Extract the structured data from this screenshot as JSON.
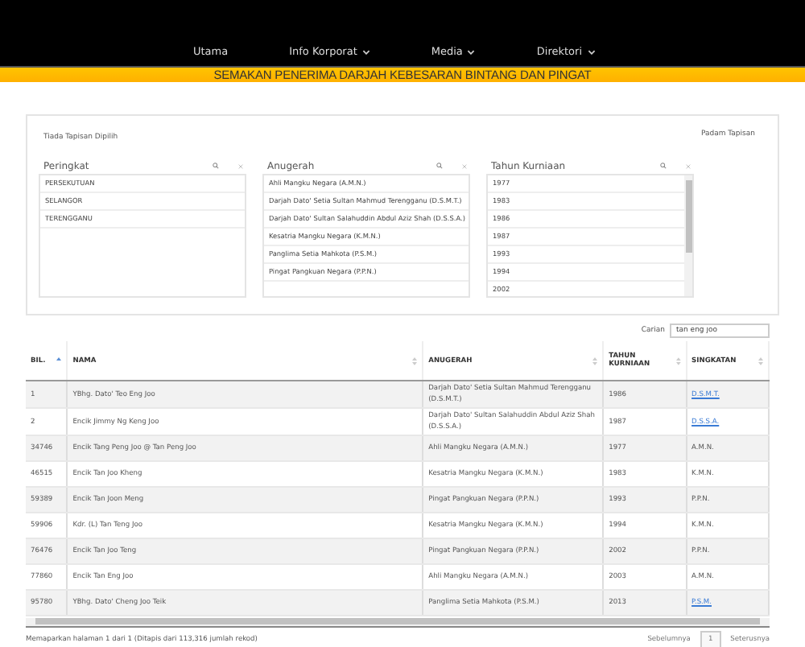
{
  "nav": [
    {
      "label": "Utama",
      "dropdown": false
    },
    {
      "label": "Info Korporat",
      "dropdown": true
    },
    {
      "label": "Media",
      "dropdown": true
    },
    {
      "label": "Direktori",
      "dropdown": true
    }
  ],
  "banner": "SEMAKAN PENERIMA DARJAH KEBESARAN BINTANG DAN PINGAT",
  "filter": {
    "status": "Tiada Tapisan Dipilih",
    "clear": "Padam Tapisan",
    "panes": [
      {
        "title": "Peringkat",
        "scroll": false,
        "items": [
          "PERSEKUTUAN",
          "SELANGOR",
          "TERENGGANU"
        ]
      },
      {
        "title": "Anugerah",
        "scroll": false,
        "items": [
          "Ahli Mangku Negara (A.M.N.)",
          "Darjah Dato' Setia Sultan Mahmud Terengganu (D.S.M.T.)",
          "Darjah Dato' Sultan Salahuddin Abdul Aziz Shah (D.S.S.A.)",
          "Kesatria Mangku Negara (K.M.N.)",
          "Panglima Setia Mahkota (P.S.M.)",
          "Pingat Pangkuan Negara (P.P.N.)"
        ]
      },
      {
        "title": "Tahun Kurniaan",
        "scroll": true,
        "items": [
          "1977",
          "1983",
          "1986",
          "1987",
          "1993",
          "1994",
          "2002"
        ]
      }
    ]
  },
  "search": {
    "label": "Carian",
    "value": "tan eng joo"
  },
  "table": {
    "columns": [
      {
        "label": "BIL.",
        "sorted": true
      },
      {
        "label": "NAMA",
        "sorted": false
      },
      {
        "label": "ANUGERAH",
        "sorted": false
      },
      {
        "label": "TAHUN KURNIAAN",
        "sorted": false
      },
      {
        "label": "SINGKATAN",
        "sorted": false
      }
    ],
    "rows": [
      {
        "bil": "1",
        "nama": "YBhg. Dato' Teo Eng Joo",
        "anugerah": "Darjah Dato' Setia Sultan Mahmud Terengganu (D.S.M.T.)",
        "tahun": "1986",
        "singkatan": "D.S.M.T.",
        "link": true
      },
      {
        "bil": "2",
        "nama": "Encik Jimmy Ng Keng Joo",
        "anugerah": "Darjah Dato' Sultan Salahuddin Abdul Aziz Shah (D.S.S.A.)",
        "tahun": "1987",
        "singkatan": "D.S.S.A.",
        "link": true
      },
      {
        "bil": "34746",
        "nama": "Encik Tang Peng Joo @ Tan Peng Joo",
        "anugerah": "Ahli Mangku Negara (A.M.N.)",
        "tahun": "1977",
        "singkatan": "A.M.N.",
        "link": false
      },
      {
        "bil": "46515",
        "nama": "Encik Tan Joo Kheng",
        "anugerah": "Kesatria Mangku Negara (K.M.N.)",
        "tahun": "1983",
        "singkatan": "K.M.N.",
        "link": false
      },
      {
        "bil": "59389",
        "nama": "Encik Tan Joon Meng",
        "anugerah": "Pingat Pangkuan Negara (P.P.N.)",
        "tahun": "1993",
        "singkatan": "P.P.N.",
        "link": false
      },
      {
        "bil": "59906",
        "nama": "Kdr. (L) Tan Teng Joo",
        "anugerah": "Kesatria Mangku Negara (K.M.N.)",
        "tahun": "1994",
        "singkatan": "K.M.N.",
        "link": false
      },
      {
        "bil": "76476",
        "nama": "Encik Tan Joo Teng",
        "anugerah": "Pingat Pangkuan Negara (P.P.N.)",
        "tahun": "2002",
        "singkatan": "P.P.N.",
        "link": false
      },
      {
        "bil": "77860",
        "nama": "Encik Tan Eng Joo",
        "anugerah": "Ahli Mangku Negara (A.M.N.)",
        "tahun": "2003",
        "singkatan": "A.M.N.",
        "link": false
      },
      {
        "bil": "95780",
        "nama": "YBhg. Dato' Cheng Joo Teik",
        "anugerah": "Panglima Setia Mahkota (P.S.M.)",
        "tahun": "2013",
        "singkatan": "P.S.M.",
        "link": true
      }
    ]
  },
  "footer": {
    "info": "Memaparkan halaman 1 dari 1 (Ditapis dari 113,316 jumlah rekod)",
    "prev": "Sebelumnya",
    "page": "1",
    "next": "Seterusnya"
  }
}
